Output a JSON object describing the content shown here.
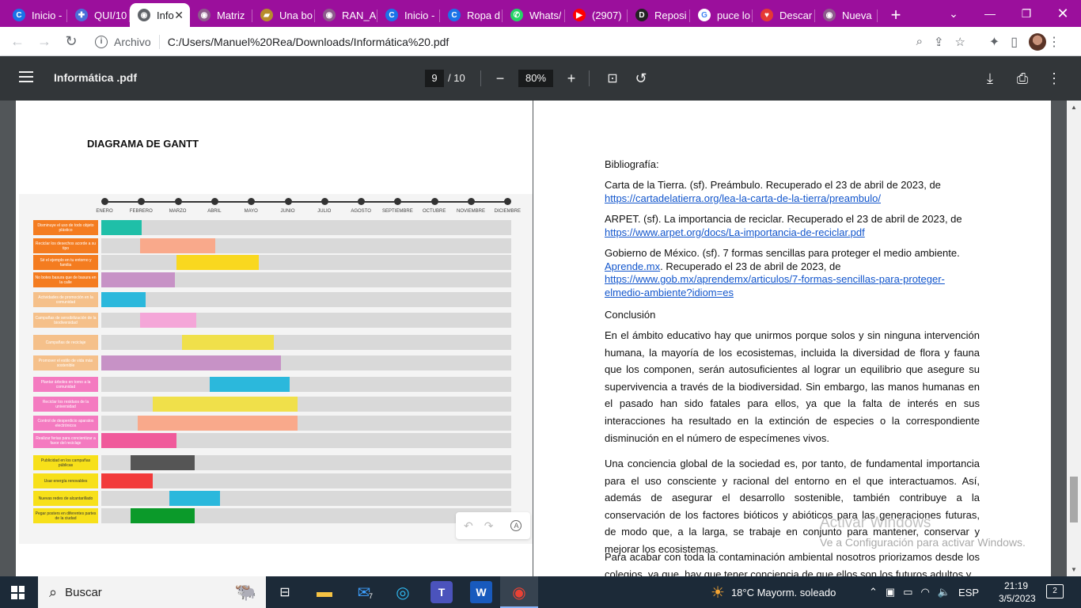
{
  "browser": {
    "tabs": [
      {
        "label": "Inicio -",
        "icon": "c-logo-icon",
        "color": "#1a73e8",
        "glyph": "C"
      },
      {
        "label": "QUI/10",
        "icon": "puzzle-icon",
        "color": "#4a6fd8",
        "glyph": "✚"
      },
      {
        "label": "Info",
        "icon": "globe-icon",
        "color": "#5f6368",
        "glyph": "◉",
        "active": true
      },
      {
        "label": "Matriz",
        "icon": "globe-icon",
        "color": "#8d5b8c",
        "glyph": "◉"
      },
      {
        "label": "Una bo",
        "icon": "book-icon",
        "color": "#b78c2b",
        "glyph": "▰"
      },
      {
        "label": "RAN_A",
        "icon": "globe-icon",
        "color": "#8d5b8c",
        "glyph": "◉"
      },
      {
        "label": "Inicio -",
        "icon": "c-logo-icon",
        "color": "#1a73e8",
        "glyph": "C"
      },
      {
        "label": "Ropa d",
        "icon": "c-logo-icon",
        "color": "#1a73e8",
        "glyph": "C"
      },
      {
        "label": "Whats/",
        "icon": "whatsapp-icon",
        "color": "#25d366",
        "glyph": "✆"
      },
      {
        "label": "(2907)",
        "icon": "youtube-icon",
        "color": "#ff0000",
        "glyph": "▶"
      },
      {
        "label": "Reposi",
        "icon": "d-logo-icon",
        "color": "#222222",
        "glyph": "D"
      },
      {
        "label": "puce lo",
        "icon": "google-icon",
        "color": "#ffffff",
        "glyph": "G"
      },
      {
        "label": "Descar",
        "icon": "heart-icon",
        "color": "#e53935",
        "glyph": "♥"
      },
      {
        "label": "Nueva",
        "icon": "globe-icon",
        "color": "#8d5b8c",
        "glyph": "◉"
      }
    ],
    "address": {
      "chip": "Archivo",
      "url": "C:/Users/Manuel%20Rea/Downloads/Informática%20.pdf"
    }
  },
  "pdf_toolbar": {
    "title": "Informática .pdf",
    "page_current": "9",
    "page_total": "/ 10",
    "zoom": "80%"
  },
  "left_page": {
    "title": "DIAGRAMA DE GANTT",
    "months": [
      "ENERO",
      "FEBRERO",
      "MARZO",
      "ABRIL",
      "MAYO",
      "JUNIO",
      "JULIO",
      "AGOSTO",
      "SEPTIEMBRE",
      "OCTUBRE",
      "NOVIEMBRE",
      "DICIEMBRE"
    ],
    "tasks": [
      {
        "label": "Disminuye el uso de todo objeto plástico",
        "label_color": "#f47c20",
        "bar_color": "#1fbfa8",
        "start": 0.0,
        "end": 1.1
      },
      {
        "label": "Reciclar los desechos acorde a su tipo",
        "label_color": "#f47c20",
        "bar_color": "#f9a98b",
        "start": 1.05,
        "end": 3.1
      },
      {
        "label": "Sé el ejemplo en tu entorno y familia",
        "label_color": "#f47c20",
        "bar_color": "#f9d81f",
        "start": 2.05,
        "end": 4.3
      },
      {
        "label": "No botes basura que de basura en la calle",
        "label_color": "#f47c20",
        "bar_color": "#c792c6",
        "start": 0.0,
        "end": 2.0
      },
      {
        "label": "Actividades de promoción en la comunidad",
        "label_color": "#f5c08a",
        "bar_color": "#2bb8dc",
        "start": 0.0,
        "end": 1.2
      },
      {
        "label": "Campañas de sensibilización de la biodiversidad",
        "label_color": "#f5c08a",
        "bar_color": "#f4a6d8",
        "start": 1.05,
        "end": 2.6
      },
      {
        "label": "Campañas de reciclaje",
        "label_color": "#f5c08a",
        "bar_color": "#f0e04a",
        "start": 2.2,
        "end": 4.7
      },
      {
        "label": "Promover el estilo de vida más sostenible",
        "label_color": "#f5c08a",
        "bar_color": "#c792c6",
        "start": 0.0,
        "end": 4.9
      },
      {
        "label": "Plantar árboles en torno a la comunidad",
        "label_color": "#f47ac0",
        "bar_color": "#2bb8dc",
        "start": 2.95,
        "end": 5.15
      },
      {
        "label": "Reciclar los residuos de la universidad",
        "label_color": "#f47ac0",
        "bar_color": "#f0e04a",
        "start": 1.4,
        "end": 5.35
      },
      {
        "label": "Control de desperdicio aparatos electrónicos",
        "label_color": "#f47ac0",
        "bar_color": "#f9a98b",
        "start": 1.0,
        "end": 5.35
      },
      {
        "label": "Realizar ferias para concientizar a favor del reciclaje",
        "label_color": "#f47ac0",
        "bar_color": "#f05a9b",
        "start": 0.0,
        "end": 2.05
      },
      {
        "label": "Publicidad en los campañas públicas",
        "label_color": "#f7e01a",
        "bar_color": "#555555",
        "start": 0.8,
        "end": 2.55
      },
      {
        "label": "Usar energía renovables",
        "label_color": "#f7e01a",
        "bar_color": "#f23b3b",
        "start": 0.0,
        "end": 1.4
      },
      {
        "label": "Nuevas redes de alcantarillado",
        "label_color": "#f7e01a",
        "bar_color": "#2bb8dc",
        "start": 1.85,
        "end": 3.25
      },
      {
        "label": "Pegar posters en diferentes partes de la ciudad",
        "label_color": "#f7e01a",
        "bar_color": "#0b9a2a",
        "start": 0.8,
        "end": 2.55
      }
    ]
  },
  "right_page": {
    "heading_biblio": "Bibliografía:",
    "refs": [
      {
        "text": "Carta de la Tierra. (sf). Preámbulo. Recuperado el 23 de abril de 2023, de",
        "link": "https://cartadelatierra.org/lea-la-carta-de-la-tierra/preambulo/"
      },
      {
        "text": "ARPET. (sf). La importancia de reciclar. Recuperado el 23 de abril de 2023, de",
        "link": "https://www.arpet.org/docs/La-importancia-de-reciclar.pdf"
      }
    ],
    "ref3_text": "Gobierno de México. (sf). 7 formas sencillas para proteger el medio ambiente.",
    "ref3_link1": "Aprende.mx",
    "ref3_mid": ". Recuperado el 23 de abril de 2023, de",
    "ref3_link2": "https://www.gob.mx/aprendemx/articulos/7-formas-sencillas-para-proteger-elmedio-ambiente?idiom=es",
    "heading_conclusion": "Conclusión",
    "para1": "En el ámbito educativo hay que unirmos porque solos y sin ninguna intervención humana, la mayoría de los ecosistemas, incluida la diversidad de flora y fauna que los componen, serán autosuficientes al lograr un equilibrio que asegure su supervivencia a través de la biodiversidad. Sin embargo, las manos humanas en el pasado han sido fatales para ellos, ya que la falta de interés en sus interacciones ha resultado en la extinción de especies o la correspondiente disminución en el número de especímenes vivos.",
    "para2": "Una conciencia global de la sociedad es, por tanto, de fundamental importancia para el uso consciente y racional del entorno en el que interactuamos. Así, además de asegurar el desarrollo sostenible, también contribuye a la conservación de los factores bióticos y abióticos para las generaciones futuras, de modo que, a la larga, se trabaje en conjunto para mantener, conservar y mejorar los ecosistemas.",
    "para3": "Para acabar con toda la contaminación ambiental nosotros priorizamos desde los colegios, ya que, hay que tener conciencia de que ellos son los futuros adultos y"
  },
  "watermark": {
    "line1": "Activar Windows",
    "line2": "Ve a Configuración para activar Windows."
  },
  "taskbar": {
    "search_placeholder": "Buscar",
    "mail_badge": "7",
    "weather": "18°C  Mayorm. soleado",
    "language": "ESP",
    "time": "21:19",
    "date": "3/5/2023",
    "notifications": "2"
  }
}
